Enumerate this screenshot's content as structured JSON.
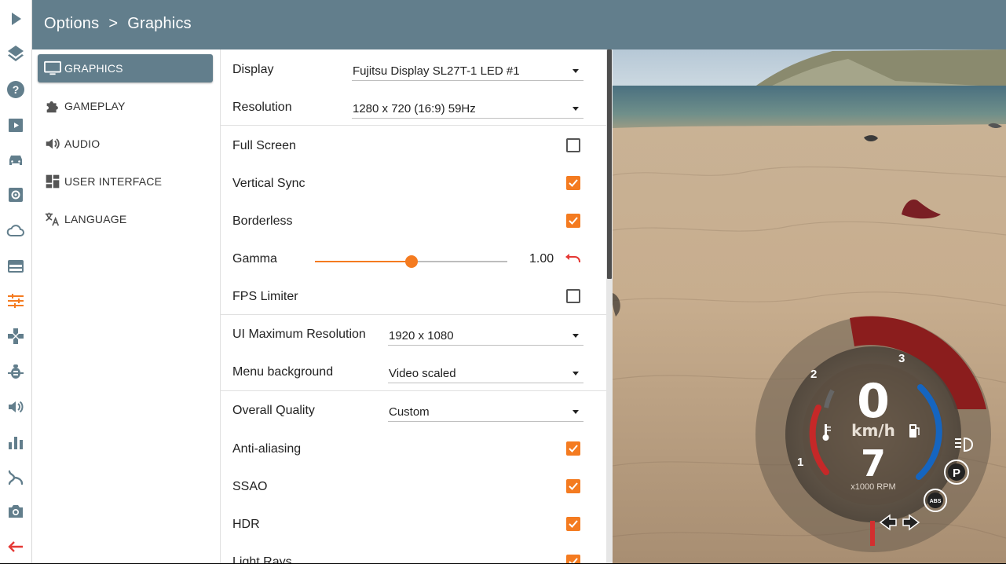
{
  "colors": {
    "accent": "#f47b20",
    "header": "#627e8c",
    "danger": "#e53935"
  },
  "header": {
    "breadcrumb_root": "Options",
    "breadcrumb_sep": ">",
    "breadcrumb_page": "Graphics"
  },
  "rail": [
    "play-icon",
    "layers-icon",
    "help-icon",
    "scenarios-icon",
    "vehicle-icon",
    "vehicle-config-icon",
    "cloud-icon",
    "environment-icon",
    "options-sliders-icon",
    "controls-icon",
    "debug-icon",
    "audio-icon",
    "performance-graph-icon",
    "track-builder-icon",
    "camera-icon",
    "back-arrow-icon"
  ],
  "categories": [
    {
      "label": "GRAPHICS",
      "icon": "monitor-icon",
      "active": true
    },
    {
      "label": "GAMEPLAY",
      "icon": "puzzle-icon",
      "active": false
    },
    {
      "label": "AUDIO",
      "icon": "speaker-icon",
      "active": false
    },
    {
      "label": "USER INTERFACE",
      "icon": "dashboard-icon",
      "active": false
    },
    {
      "label": "LANGUAGE",
      "icon": "translate-icon",
      "active": false
    }
  ],
  "settings": {
    "display": {
      "label": "Display",
      "value": "Fujitsu Display SL27T-1 LED #1"
    },
    "resolution": {
      "label": "Resolution",
      "value": "1280 x 720 (16:9) 59Hz"
    },
    "fullscreen": {
      "label": "Full Screen",
      "checked": false
    },
    "vsync": {
      "label": "Vertical Sync",
      "checked": true
    },
    "borderless": {
      "label": "Borderless",
      "checked": true
    },
    "gamma": {
      "label": "Gamma",
      "value": "1.00",
      "slider_fraction": 0.5
    },
    "fps_limiter": {
      "label": "FPS Limiter",
      "checked": false
    },
    "ui_max_res": {
      "label": "UI Maximum Resolution",
      "value": "1920 x 1080"
    },
    "menu_bg": {
      "label": "Menu background",
      "value": "Video scaled"
    },
    "overall_quality": {
      "label": "Overall Quality",
      "value": "Custom"
    },
    "anti_aliasing": {
      "label": "Anti-aliasing",
      "checked": true
    },
    "ssao": {
      "label": "SSAO",
      "checked": true
    },
    "hdr": {
      "label": "HDR",
      "checked": true
    },
    "light_rays": {
      "label": "Light Rays",
      "checked": true
    }
  },
  "gauge": {
    "speed": "0",
    "speed_unit": "km/h",
    "gear": "7",
    "rpm_unit": "x1000 RPM",
    "ticks": [
      "1",
      "2",
      "3"
    ],
    "abs": "ABS",
    "park": "P"
  }
}
